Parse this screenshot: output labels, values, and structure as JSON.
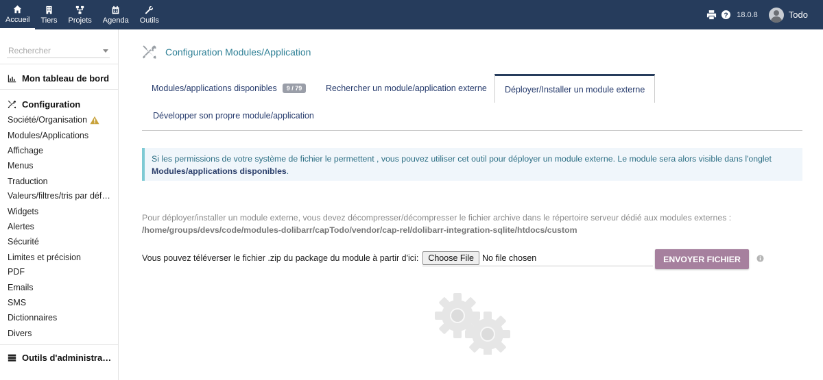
{
  "topnav": [
    {
      "label": "Accueil",
      "icon": "home-icon",
      "active": true
    },
    {
      "label": "Tiers",
      "icon": "building-icon"
    },
    {
      "label": "Projets",
      "icon": "sitemap-icon"
    },
    {
      "label": "Agenda",
      "icon": "calendar-icon"
    },
    {
      "label": "Outils",
      "icon": "wrench-icon"
    }
  ],
  "topright": {
    "version": "18.0.8",
    "user": "Todo"
  },
  "sidebar": {
    "search_placeholder": "Rechercher",
    "dashboard": "Mon tableau de bord",
    "configuration": "Configuration",
    "items": [
      "Société/Organisation",
      "Modules/Applications",
      "Affichage",
      "Menus",
      "Traduction",
      "Valeurs/filtres/tris par défaut",
      "Widgets",
      "Alertes",
      "Sécurité",
      "Limites et précision",
      "PDF",
      "Emails",
      "SMS",
      "Dictionnaires",
      "Divers"
    ],
    "admin_tools": "Outils d'administration"
  },
  "main": {
    "title": "Configuration Modules/Application",
    "tabs": [
      {
        "label": "Modules/applications disponibles",
        "badge": "9 / 79"
      },
      {
        "label": "Rechercher un module/application externe"
      },
      {
        "label": "Déployer/Installer un module externe",
        "active": true
      },
      {
        "label": "Développer son propre module/application"
      }
    ],
    "info_text": "Si les permissions de votre système de fichier le permettent , vous pouvez utiliser cet outil pour déployer un module externe. Le module sera alors visible dans l'onglet ",
    "info_bold": "Modules/applications disponibles",
    "info_end": ".",
    "deploy_text": "Pour déployer/installer un module externe, vous devez décompresser/décompresser le fichier archive dans le répertoire serveur dédié aux modules externes :",
    "deploy_path": "/home/groups/devs/code/modules-dolibarr/capTodo/vendor/cap-rel/dolibarr-integration-sqlite/htdocs/custom",
    "upload_label": "Vous pouvez téléverser le fichier .zip du package du module à partir d'ici:",
    "choose_file": "Choose File",
    "no_file": "No file chosen",
    "send_button": "ENVOYER FICHIER"
  },
  "colors": {
    "topbar": "#263c5c",
    "accent": "#2d7f95",
    "send_button": "#a6809e",
    "info_border": "#7ecad4"
  }
}
